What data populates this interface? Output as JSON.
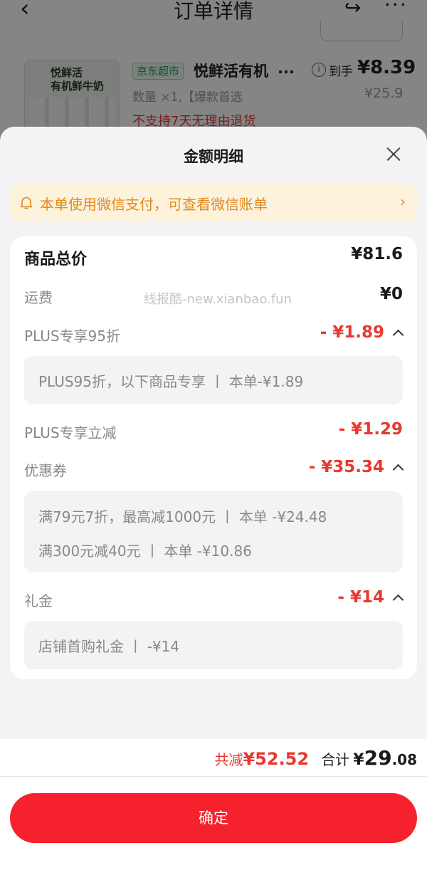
{
  "background_page": {
    "title": "订单详情",
    "product": {
      "store_tag": "京东超市",
      "name": "悦鲜活有机",
      "ellipsis": "...",
      "arrival_label": "到手",
      "arrival_price": "¥8.39",
      "original_price": "¥25.9",
      "quantity_spec": "数量 ×1,【爆款首选",
      "return_policy": "不支持7天无理由退货",
      "thumbnail_text": "悦鲜活\n有机鲜牛奶"
    }
  },
  "sheet": {
    "title": "金额明细",
    "notice": "本单使用微信支付，可查看微信账单",
    "watermark": "线报酷-new.xianbao.fun",
    "rows": {
      "total_label": "商品总价",
      "total_value": "¥81.6",
      "shipping_label": "运费",
      "shipping_value": "¥0",
      "plus95_label": "PLUS专享95折",
      "plus95_value": "- ¥1.89",
      "plus95_detail": "PLUS95折，以下商品专享 丨 本单-¥1.89",
      "plus_reduce_label": "PLUS专享立减",
      "plus_reduce_value": "- ¥1.29",
      "coupon_label": "优惠券",
      "coupon_value": "- ¥35.34",
      "coupon_detail_1": "满79元7折，最高减1000元 丨 本单 -¥24.48",
      "coupon_detail_2": "满300元减40元 丨 本单 -¥10.86",
      "gift_label": "礼金",
      "gift_value": "- ¥14",
      "gift_detail": "店铺首购礼金 丨 -¥14"
    }
  },
  "footer": {
    "discount_label": "共减",
    "discount_value": "¥52.52",
    "total_label": "合计",
    "total_yen": "¥",
    "total_int": "29",
    "total_dec": ".08",
    "confirm_label": "确定"
  },
  "colors": {
    "accent_red": "#e8382f",
    "button_red": "#f5222d",
    "notice_bg": "#fdf3dd",
    "notice_text": "#e08a1c",
    "store_tag_green": "#1f9b5a"
  },
  "icons": [
    "back-arrow-icon",
    "share-icon",
    "more-icon",
    "info-icon",
    "close-icon",
    "bell-icon",
    "chevron-right-icon",
    "chevron-up-icon"
  ]
}
